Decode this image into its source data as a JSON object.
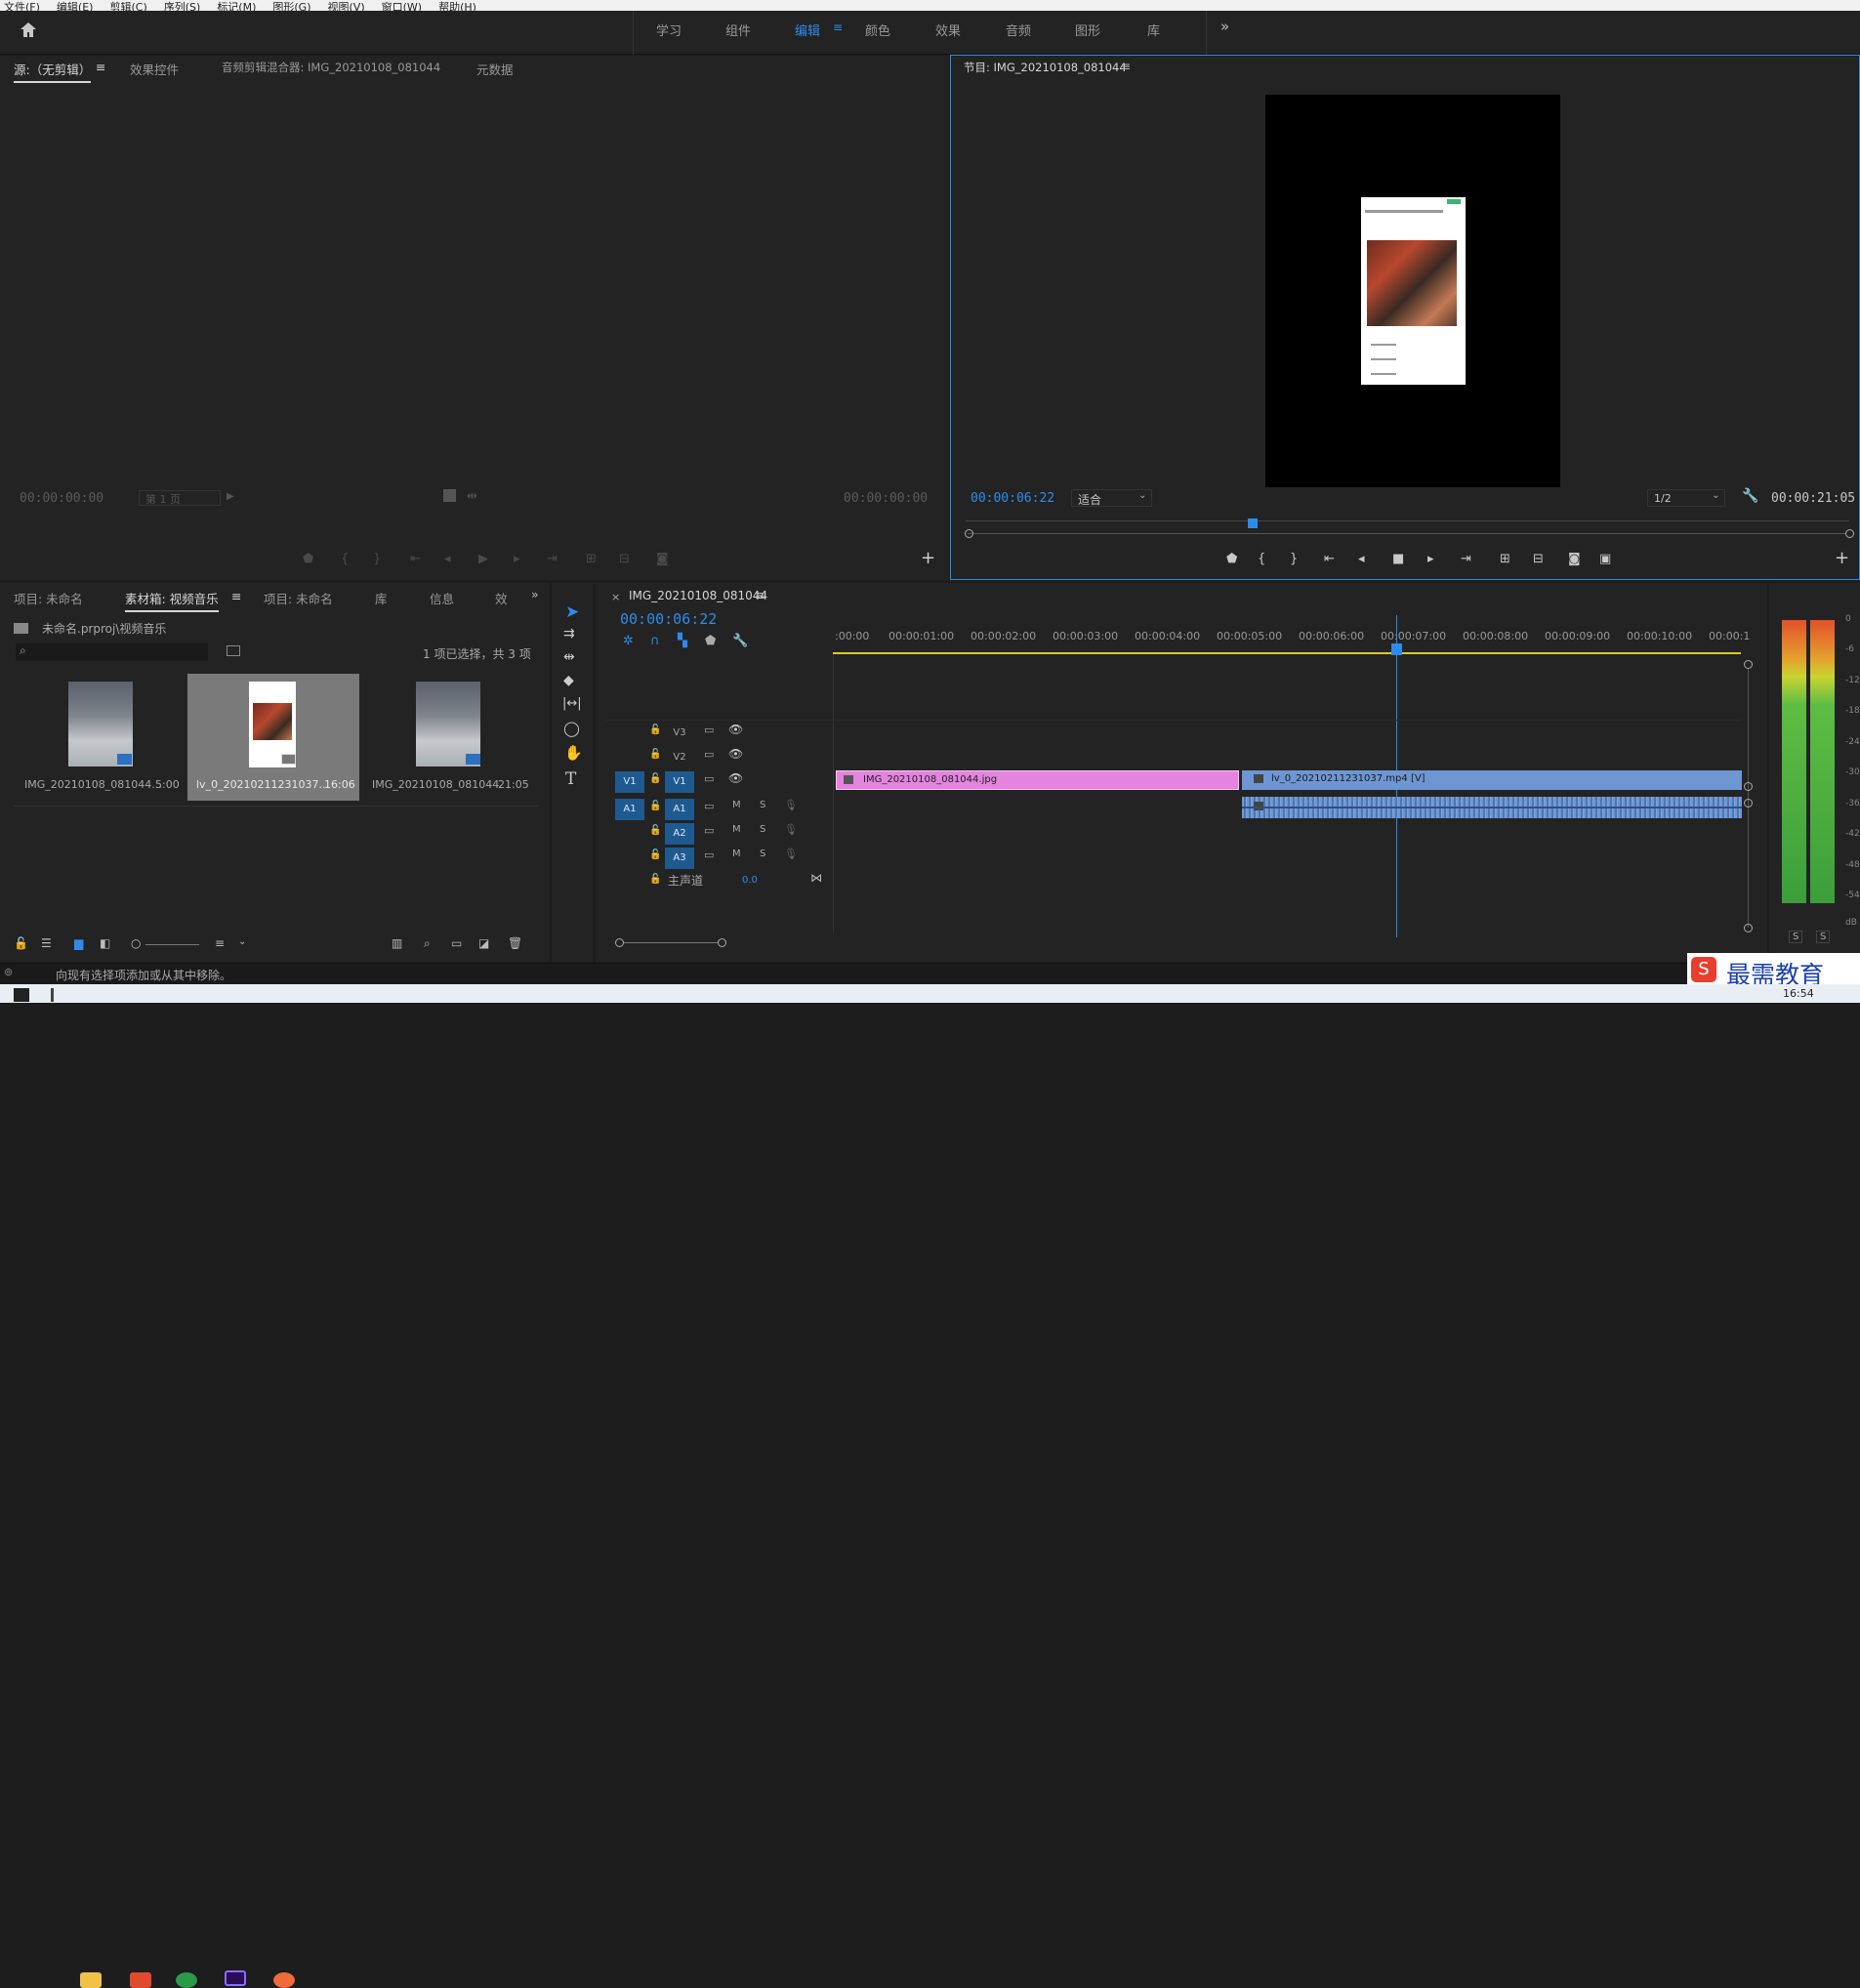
{
  "menu": [
    "文件(F)",
    "编辑(E)",
    "剪辑(C)",
    "序列(S)",
    "标记(M)",
    "图形(G)",
    "视图(V)",
    "窗口(W)",
    "帮助(H)"
  ],
  "workspaces": [
    {
      "label": "学习"
    },
    {
      "label": "组件"
    },
    {
      "label": "编辑"
    },
    {
      "label": "颜色"
    },
    {
      "label": "效果"
    },
    {
      "label": "音频"
    },
    {
      "label": "图形"
    },
    {
      "label": "库"
    }
  ],
  "source": {
    "tabs": [
      "源:（无剪辑）",
      "效果控件",
      "音频剪辑混合器: IMG_20210108_081044",
      "元数据"
    ],
    "tc_left": "00:00:00:00",
    "page": "第 1 页",
    "tc_right": "00:00:00:00"
  },
  "program": {
    "title": "节目: IMG_20210108_081044",
    "tc_current": "00:00:06:22",
    "fit": "适合",
    "quality": "1/2",
    "tc_total": "00:00:21:05"
  },
  "project": {
    "tabs": [
      "项目: 未命名",
      "素材箱: 视频音乐",
      "项目: 未命名",
      "库",
      "信息",
      "效"
    ],
    "path": "未命名.prproj\\视频音乐",
    "selection": "1 项已选择，共 3 项",
    "items": [
      {
        "name": "IMG_20210108_081044...",
        "dur": "5:00"
      },
      {
        "name": "lv_0_20210211231037...",
        "dur": "16:06"
      },
      {
        "name": "IMG_20210108_081044",
        "dur": "21:05"
      }
    ]
  },
  "timeline": {
    "tab": "IMG_20210108_081044",
    "tc": "00:00:06:22",
    "ruler": [
      ":00:00",
      "00:00:01:00",
      "00:00:02:00",
      "00:00:03:00",
      "00:00:04:00",
      "00:00:05:00",
      "00:00:06:00",
      "00:00:07:00",
      "00:00:08:00",
      "00:00:09:00",
      "00:00:10:00",
      "00:00:1"
    ],
    "tracks": {
      "v3": "V3",
      "v2": "V2",
      "v1_src": "V1",
      "v1": "V1",
      "a1_src": "A1",
      "a1": "A1",
      "a2": "A2",
      "a3": "A3",
      "m": "M",
      "s": "S"
    },
    "master": "主声道",
    "master_val": "0.0",
    "clip1": "IMG_20210108_081044.jpg",
    "clip2": "lv_0_20210211231037.mp4 [V]"
  },
  "meter": {
    "labels": [
      "0",
      "-6",
      "-12",
      "-18",
      "-24",
      "-30",
      "-36",
      "-42",
      "-48",
      "-54",
      "dB"
    ],
    "s1": "S",
    "s2": "S"
  },
  "status": "向现有选择项添加或从其中移除。",
  "watermark": "最需教育",
  "clock": "16:54",
  "colors": {
    "accent": "#2d8ceb",
    "clip_pink": "#e484df",
    "clip_blue": "#6e96d2"
  }
}
